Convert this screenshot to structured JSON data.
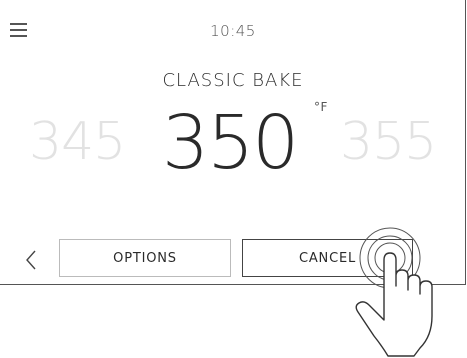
{
  "header": {
    "menu_icon": "hamburger-menu-icon",
    "time": "10:45"
  },
  "main": {
    "mode_title": "CLASSIC BAKE",
    "temperature": {
      "previous": "345",
      "current": "350",
      "next": "355",
      "unit": "°F"
    }
  },
  "footer": {
    "back_icon": "chevron-left-icon",
    "options_label": "OPTIONS",
    "cancel_label": "CANCEL"
  },
  "overlay": {
    "gesture_icon": "tap-hand-icon"
  },
  "colors": {
    "text": "#2a2a2a",
    "faded_temp": "#e2e2e2",
    "border": "#444444"
  }
}
